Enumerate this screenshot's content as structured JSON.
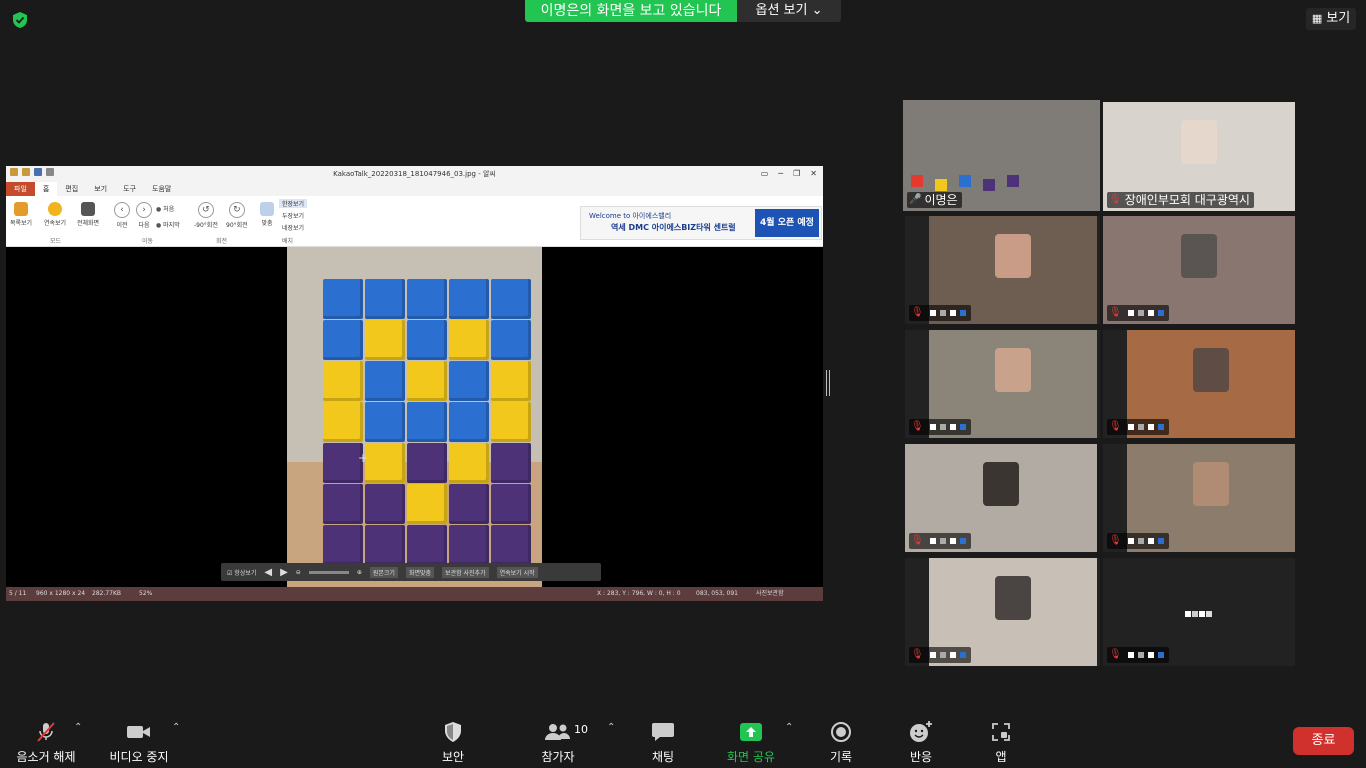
{
  "top": {
    "security_icon": "shield-check-icon",
    "share_banner": "이명은의 화면을 보고 있습니다",
    "view_options": "옵션 보기",
    "view_button": "보기"
  },
  "viewer": {
    "title": "KakaoTalk_20220318_181047946_03.jpg - 알씨",
    "menu": [
      "파일",
      "홈",
      "편집",
      "보기",
      "도구",
      "도움말"
    ],
    "ribbon": {
      "buttons": [
        "목록보기",
        "연속보기",
        "전체화면",
        "이전",
        "다음",
        "처음",
        "마지막",
        "-90°회전",
        "90°회전",
        "맞춤"
      ],
      "view_modes": [
        "한장보기",
        "두장보기",
        "네장보기"
      ],
      "groups": [
        "모드",
        "이동",
        "회전",
        "배치"
      ]
    },
    "ad": {
      "line1": "Welcome to 아이에스밸리",
      "line2": "역세 DMC 아이에스BIZ타워 센트럴",
      "badge": "4월 오픈 예정"
    },
    "image_toolbar": [
      "항상보기",
      "원본크기",
      "화면맞춤",
      "보관함 사진추가",
      "연속보기 시작"
    ],
    "status": {
      "index": "5 / 11",
      "dimensions": "960 x 1280 x 24",
      "filesize": "282.77KB",
      "zoom": "52%",
      "coords": "X : 283, Y : 796, W : 0, H : 0",
      "color": "083, 053, 091",
      "album": "사진보관함"
    }
  },
  "participants": [
    {
      "name": "이명은",
      "muted": false,
      "active": true
    },
    {
      "name": "장애인부모회 대구광역시",
      "muted": true,
      "active": false
    },
    {
      "name": "",
      "muted": true,
      "active": false
    },
    {
      "name": "",
      "muted": true,
      "active": false
    },
    {
      "name": "",
      "muted": true,
      "active": false
    },
    {
      "name": "",
      "muted": true,
      "active": false
    },
    {
      "name": "",
      "muted": true,
      "active": false
    },
    {
      "name": "",
      "muted": true,
      "active": false
    },
    {
      "name": "",
      "muted": true,
      "active": false
    },
    {
      "name": "",
      "muted": true,
      "active": false
    }
  ],
  "toolbar": {
    "unmute": "음소거 해제",
    "stop_video": "비디오 중지",
    "security": "보안",
    "participants": "참가자",
    "participant_count": "10",
    "chat": "채팅",
    "share_screen": "화면 공유",
    "record": "기록",
    "reactions": "반응",
    "apps": "앱",
    "end": "종료"
  },
  "colors": {
    "share_green": "#23c552",
    "active_speaker": "#c8e04a",
    "end_red": "#d0312d",
    "cube_blue": "#2b6fd0",
    "cube_yellow": "#f2c81c",
    "cube_purple": "#4e3278"
  }
}
